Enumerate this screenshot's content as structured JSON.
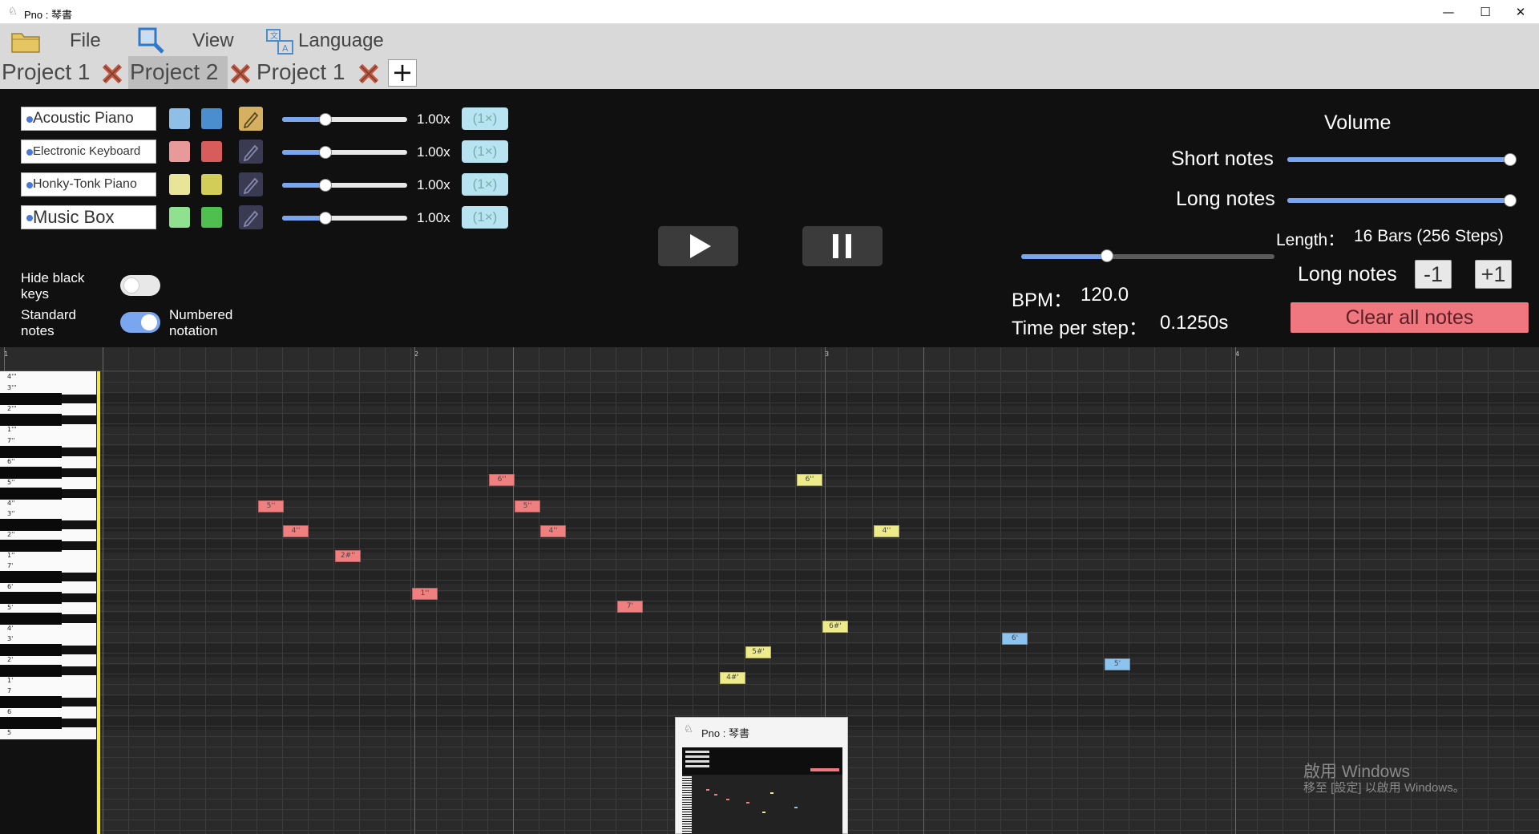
{
  "window": {
    "title": "Pno : 琴書",
    "controls": [
      "—",
      "☐",
      "✕"
    ]
  },
  "menu": {
    "file": "File",
    "view": "View",
    "language": "Language"
  },
  "tabs": [
    {
      "label": "Project 1",
      "active": false
    },
    {
      "label": "Project 2",
      "active": true
    },
    {
      "label": "Project 1",
      "active": false
    }
  ],
  "tab_add": "+",
  "instruments": [
    {
      "name": "Acoustic Piano",
      "color_light": "#8fbfe6",
      "color_dark": "#4a8ed0",
      "speed": "1.00x",
      "mult": "(1×)",
      "selected": true
    },
    {
      "name": "Electronic Keyboard",
      "color_light": "#e89a9a",
      "color_dark": "#d95c5c",
      "speed": "1.00x",
      "mult": "(1×)",
      "selected": false
    },
    {
      "name": "Honky-Tonk Piano",
      "color_light": "#e8e49a",
      "color_dark": "#d2cc58",
      "speed": "1.00x",
      "mult": "(1×)",
      "selected": false
    },
    {
      "name": "Music Box",
      "color_light": "#8fe08f",
      "color_dark": "#4fc04f",
      "speed": "1.00x",
      "mult": "(1×)",
      "selected": false
    }
  ],
  "toggles": {
    "hide_black_keys": "Hide black keys",
    "standard_notes": "Standard notes",
    "numbered_notation": "Numbered notation",
    "hide_black_keys_on": false,
    "notation_numbered_on": true
  },
  "volume": {
    "title": "Volume",
    "short_notes": "Short notes",
    "long_notes": "Long notes",
    "short_level": 1.0,
    "long_level": 1.0
  },
  "tempo": {
    "length_label": "Length：",
    "length_value": "16 Bars (256 Steps)",
    "long_notes_label": "Long notes",
    "minus": "-1",
    "plus": "+1",
    "bpm_label": "BPM：",
    "bpm_value": "120.0",
    "time_label": "Time per step：",
    "time_value": "0.1250s",
    "bpm_slider_level": 0.34,
    "clear": "Clear all notes"
  },
  "ruler": [
    "1",
    "2",
    "3",
    "4"
  ],
  "keys": [
    "4'''",
    "3'''",
    "2'''",
    "1'''",
    "7''",
    "6''",
    "5''",
    "4''",
    "3''",
    "2''",
    "1''",
    "7'",
    "6'",
    "5'",
    "4'",
    "3'",
    "2'",
    "1'",
    "7",
    "6",
    "5"
  ],
  "notes": [
    {
      "label": "5''",
      "color": "red"
    },
    {
      "label": "4''",
      "color": "red"
    },
    {
      "label": "2#''",
      "color": "red"
    },
    {
      "label": "1''",
      "color": "red"
    },
    {
      "label": "6''",
      "color": "red"
    },
    {
      "label": "5''",
      "color": "red"
    },
    {
      "label": "4''",
      "color": "red"
    },
    {
      "label": "7'",
      "color": "red"
    },
    {
      "label": "4#'",
      "color": "yellow"
    },
    {
      "label": "5#'",
      "color": "yellow"
    },
    {
      "label": "6''",
      "color": "yellow"
    },
    {
      "label": "6#'",
      "color": "yellow"
    },
    {
      "label": "4''",
      "color": "yellow"
    },
    {
      "label": "6'",
      "color": "blue"
    },
    {
      "label": "5'",
      "color": "blue"
    }
  ],
  "taskbar_preview": {
    "title": "Pno : 琴書"
  },
  "watermark": {
    "line1": "啟用 Windows",
    "line2": "移至 [設定] 以啟用 Windows。"
  }
}
